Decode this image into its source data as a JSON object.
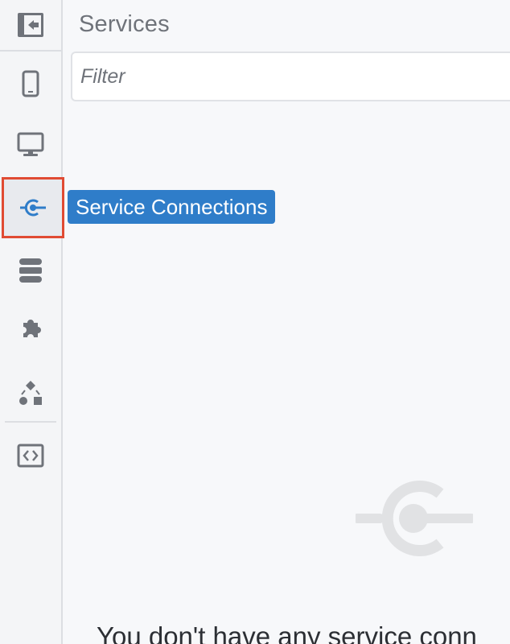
{
  "header": {
    "title": "Services"
  },
  "filter": {
    "placeholder": "Filter",
    "value": ""
  },
  "sidebar": {
    "items": [
      {
        "name": "collapse-panel",
        "icon": "panel-collapse-icon"
      },
      {
        "name": "mobile",
        "icon": "mobile-device-icon"
      },
      {
        "name": "desktop",
        "icon": "desktop-monitor-icon"
      },
      {
        "name": "service-connections",
        "icon": "service-connection-icon",
        "active": true
      },
      {
        "name": "data-storage",
        "icon": "database-icon"
      },
      {
        "name": "plugins",
        "icon": "puzzle-piece-icon"
      },
      {
        "name": "flows",
        "icon": "shapes-flow-icon"
      },
      {
        "name": "code",
        "icon": "code-brackets-icon"
      }
    ]
  },
  "tooltip": {
    "label": "Service Connections"
  },
  "empty_state": {
    "icon": "service-connection-icon",
    "message": "You don't have any service conn"
  },
  "colors": {
    "accent_blue": "#2f7dc9",
    "active_outline": "#e04b33",
    "icon_gray": "#6f737a"
  }
}
